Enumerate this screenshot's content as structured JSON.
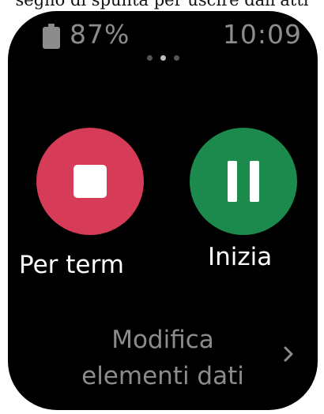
{
  "caption": {
    "text": "segno di spunta per uscire dall'atti"
  },
  "status_bar": {
    "battery_percent": "87%",
    "time": "10:09"
  },
  "pager": {
    "total": 3,
    "active_index": 1
  },
  "actions": {
    "stop": {
      "label": "Per term",
      "color": "#d63b58",
      "icon": "stop-icon"
    },
    "resume": {
      "label": "Inizia",
      "color": "#1b8a4c",
      "icon": "pause-icon"
    }
  },
  "edit_fields": {
    "line1": "Modifica",
    "line2": "elementi dati",
    "icon": "chevron-right-icon"
  }
}
